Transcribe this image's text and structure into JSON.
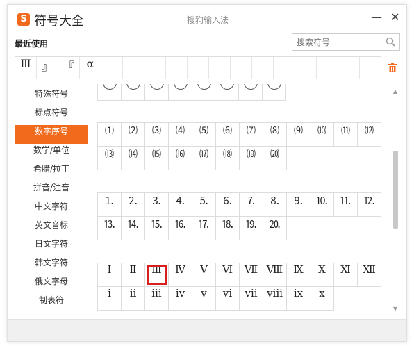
{
  "window": {
    "title": "符号大全",
    "ime_name": "搜狗输入法",
    "logo_text": "S",
    "minimize_glyph": "—",
    "close_glyph": "✕"
  },
  "recent": {
    "label": "最近使用",
    "items": [
      "Ⅲ",
      "』",
      "『",
      "α",
      "",
      "",
      "",
      "",
      "",
      "",
      "",
      "",
      "",
      "",
      "",
      "",
      ""
    ]
  },
  "search": {
    "placeholder": "搜索符号",
    "value": ""
  },
  "sidebar": {
    "items": [
      {
        "label": "特殊符号",
        "active": false
      },
      {
        "label": "标点符号",
        "active": false
      },
      {
        "label": "数字序号",
        "active": true
      },
      {
        "label": "数学/单位",
        "active": false
      },
      {
        "label": "希腊/拉丁",
        "active": false
      },
      {
        "label": "拼音/注音",
        "active": false
      },
      {
        "label": "中文字符",
        "active": false
      },
      {
        "label": "英文音标",
        "active": false
      },
      {
        "label": "日文字符",
        "active": false
      },
      {
        "label": "韩文字符",
        "active": false
      },
      {
        "label": "俄文字母",
        "active": false
      },
      {
        "label": "制表符",
        "active": false
      }
    ]
  },
  "groups": {
    "parenthesized": [
      "⑴",
      "⑵",
      "⑶",
      "⑷",
      "⑸",
      "⑹",
      "⑺",
      "⑻",
      "⑼",
      "⑽",
      "⑾",
      "⑿",
      "⒀",
      "⒁",
      "⒂",
      "⒃",
      "⒄",
      "⒅",
      "⒆",
      "⒇"
    ],
    "period": [
      "⒈",
      "⒉",
      "⒊",
      "⒋",
      "⒌",
      "⒍",
      "⒎",
      "⒏",
      "⒐",
      "⒑",
      "⒒",
      "⒓",
      "⒔",
      "⒕",
      "⒖",
      "⒗",
      "⒘",
      "⒙",
      "⒚",
      "⒛"
    ],
    "roman": [
      "Ⅰ",
      "Ⅱ",
      "Ⅲ",
      "Ⅳ",
      "Ⅴ",
      "Ⅵ",
      "Ⅶ",
      "Ⅷ",
      "Ⅸ",
      "Ⅹ",
      "Ⅺ",
      "Ⅻ",
      "ⅰ",
      "ⅱ",
      "ⅲ",
      "ⅳ",
      "ⅴ",
      "ⅵ",
      "ⅶ",
      "ⅷ",
      "ⅸ",
      "ⅹ"
    ],
    "roman_selected_index": 2
  },
  "colors": {
    "accent": "#f26a1b",
    "selected_outline": "#d81f1f"
  }
}
